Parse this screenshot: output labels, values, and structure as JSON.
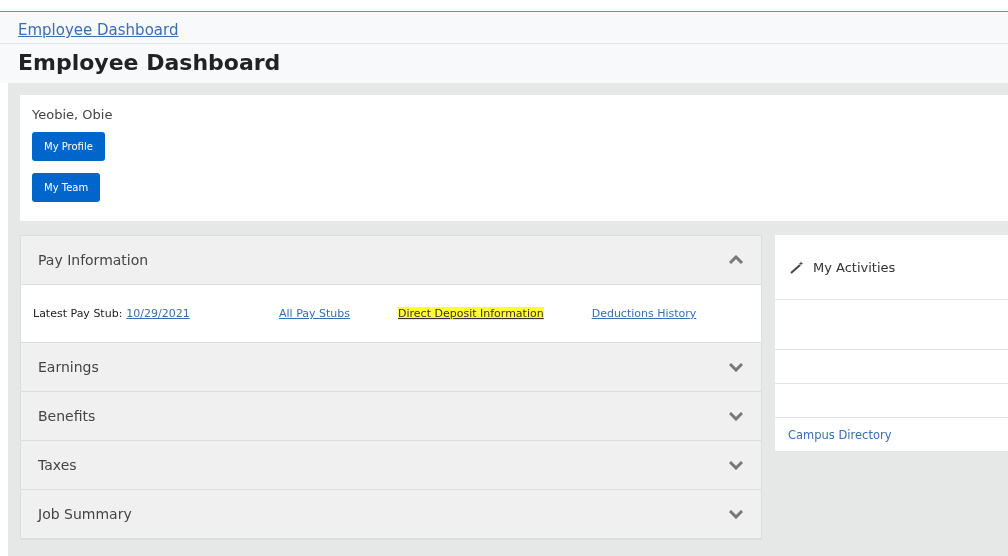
{
  "breadcrumb": "Employee Dashboard",
  "title": "Employee Dashboard",
  "profile": {
    "name": "Yeobie, Obie",
    "buttons": [
      "My Profile",
      "My Team"
    ]
  },
  "sections": [
    {
      "title": "Pay Information",
      "expanded": true,
      "latest_label": "Latest Pay Stub:",
      "latest_link": "10/29/2021",
      "links": [
        {
          "label": "All Pay Stubs",
          "highlighted": false
        },
        {
          "label": "Direct Deposit Information",
          "highlighted": true
        },
        {
          "label": "Deductions History",
          "highlighted": false
        }
      ]
    },
    {
      "title": "Earnings",
      "expanded": false
    },
    {
      "title": "Benefits",
      "expanded": false
    },
    {
      "title": "Taxes",
      "expanded": false
    },
    {
      "title": "Job Summary",
      "expanded": false
    }
  ],
  "activities": {
    "title": "My Activities",
    "links": [
      "Campus Directory"
    ]
  }
}
